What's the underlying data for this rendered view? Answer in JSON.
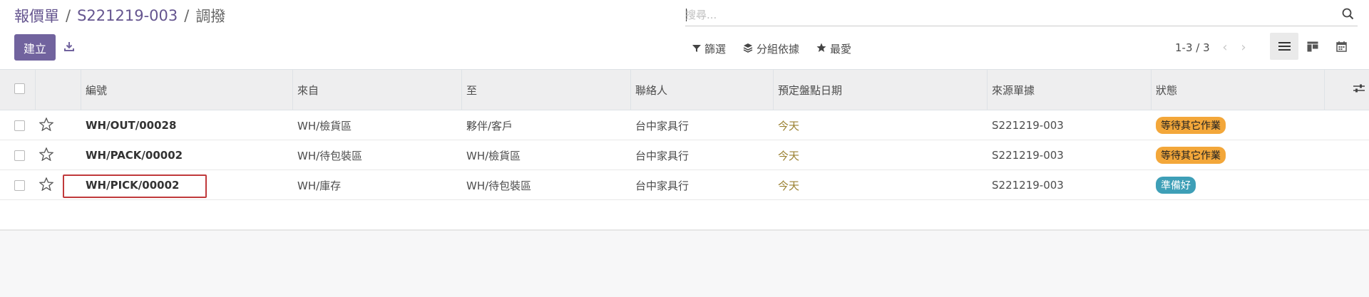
{
  "breadcrumb": {
    "items": [
      "報價單",
      "S221219-003"
    ],
    "current": "調撥",
    "separator": "/"
  },
  "toolbar": {
    "create_label": "建立"
  },
  "search": {
    "placeholder": "搜尋..."
  },
  "filters": {
    "filter_label": "篩選",
    "group_label": "分組依據",
    "favorites_label": "最愛"
  },
  "pager": {
    "text": "1-3 / 3"
  },
  "columns": {
    "reference": "編號",
    "from": "來自",
    "to": "至",
    "contact": "聯絡人",
    "scheduled": "預定盤點日期",
    "source": "來源單據",
    "status": "狀態"
  },
  "rows": [
    {
      "reference": "WH/OUT/00028",
      "from": "WH/檢貨區",
      "to": "夥伴/客戶",
      "contact": "台中家具行",
      "scheduled": "今天",
      "source": "S221219-003",
      "status": "等待其它作業",
      "status_type": "waiting"
    },
    {
      "reference": "WH/PACK/00002",
      "from": "WH/待包裝區",
      "to": "WH/檢貨區",
      "contact": "台中家具行",
      "scheduled": "今天",
      "source": "S221219-003",
      "status": "等待其它作業",
      "status_type": "waiting"
    },
    {
      "reference": "WH/PICK/00002",
      "from": "WH/庫存",
      "to": "WH/待包裝區",
      "contact": "台中家具行",
      "scheduled": "今天",
      "source": "S221219-003",
      "status": "準備好",
      "status_type": "ready"
    }
  ],
  "colors": {
    "brand": "#71639e",
    "waiting_badge": "#f3a73a",
    "ready_badge": "#3e9fb7",
    "today_text": "#9b8131",
    "highlight_box": "#c0393b"
  },
  "icons": {
    "download": "download-icon",
    "search": "search-icon",
    "filter": "filter-icon",
    "group": "layers-icon",
    "favorites": "star-icon",
    "prev": "chevron-left-icon",
    "next": "chevron-right-icon",
    "list_view": "list-view-icon",
    "kanban_view": "kanban-view-icon",
    "calendar_view": "calendar-view-icon",
    "optional_columns": "sliders-icon"
  }
}
